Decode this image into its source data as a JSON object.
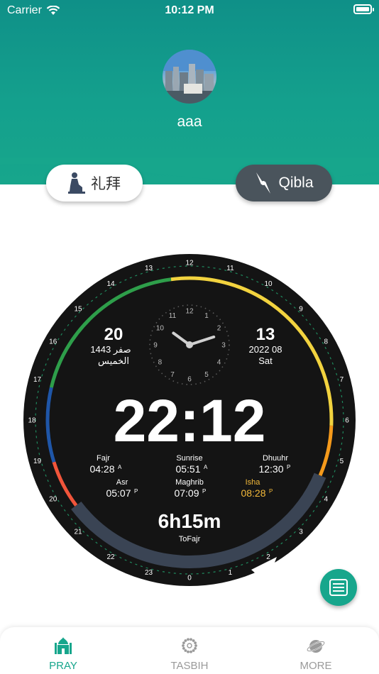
{
  "status_bar": {
    "carrier": "Carrier",
    "time": "10:12 PM"
  },
  "profile": {
    "username": "aaa"
  },
  "actions": {
    "pray_label": "礼拜",
    "qibla_label": "Qibla"
  },
  "dial": {
    "hijri": {
      "day": "20",
      "month_year": "1443 صفر",
      "weekday": "الخميس"
    },
    "gregorian": {
      "day": "13",
      "year_month": "2022 08",
      "weekday": "Sat"
    },
    "current_time": "22:12",
    "countdown": "6h15m",
    "countdown_label": "ToFajr",
    "outer_hours": [
      "0",
      "1",
      "2",
      "3",
      "4",
      "5",
      "6",
      "7",
      "8",
      "9",
      "10",
      "11",
      "12",
      "13",
      "14",
      "15",
      "16",
      "17",
      "18",
      "19",
      "20",
      "21",
      "22",
      "23"
    ],
    "inner_hours": [
      "12",
      "1",
      "2",
      "3",
      "4",
      "5",
      "6",
      "7",
      "8",
      "9",
      "10",
      "11"
    ],
    "analog_time": {
      "hour": 10,
      "minute": 12
    },
    "prayers": [
      {
        "name": "Fajr",
        "time": "04:28",
        "suffix": "A",
        "highlight": false
      },
      {
        "name": "Sunrise",
        "time": "05:51",
        "suffix": "A",
        "highlight": false
      },
      {
        "name": "Dhuuhr",
        "time": "12:30",
        "suffix": "P",
        "highlight": false
      },
      {
        "name": "Asr",
        "time": "05:07",
        "suffix": "P",
        "highlight": false
      },
      {
        "name": "Maghrib",
        "time": "07:09",
        "suffix": "P",
        "highlight": false
      },
      {
        "name": "Isha",
        "time": "08:28",
        "suffix": "P",
        "highlight": true
      }
    ],
    "colors": {
      "yellow": "#f2d33f",
      "green": "#2e9e4a",
      "blue": "#1f56a8",
      "red": "#f1553b",
      "orange": "#f59a1b",
      "night": "#3a4454",
      "highlight": "#f3b93a"
    }
  },
  "tabs": [
    {
      "label": "PRAY",
      "icon": "mosque-icon",
      "active": true
    },
    {
      "label": "TASBIH",
      "icon": "beads-icon",
      "active": false
    },
    {
      "label": "MORE",
      "icon": "planet-icon",
      "active": false
    }
  ]
}
